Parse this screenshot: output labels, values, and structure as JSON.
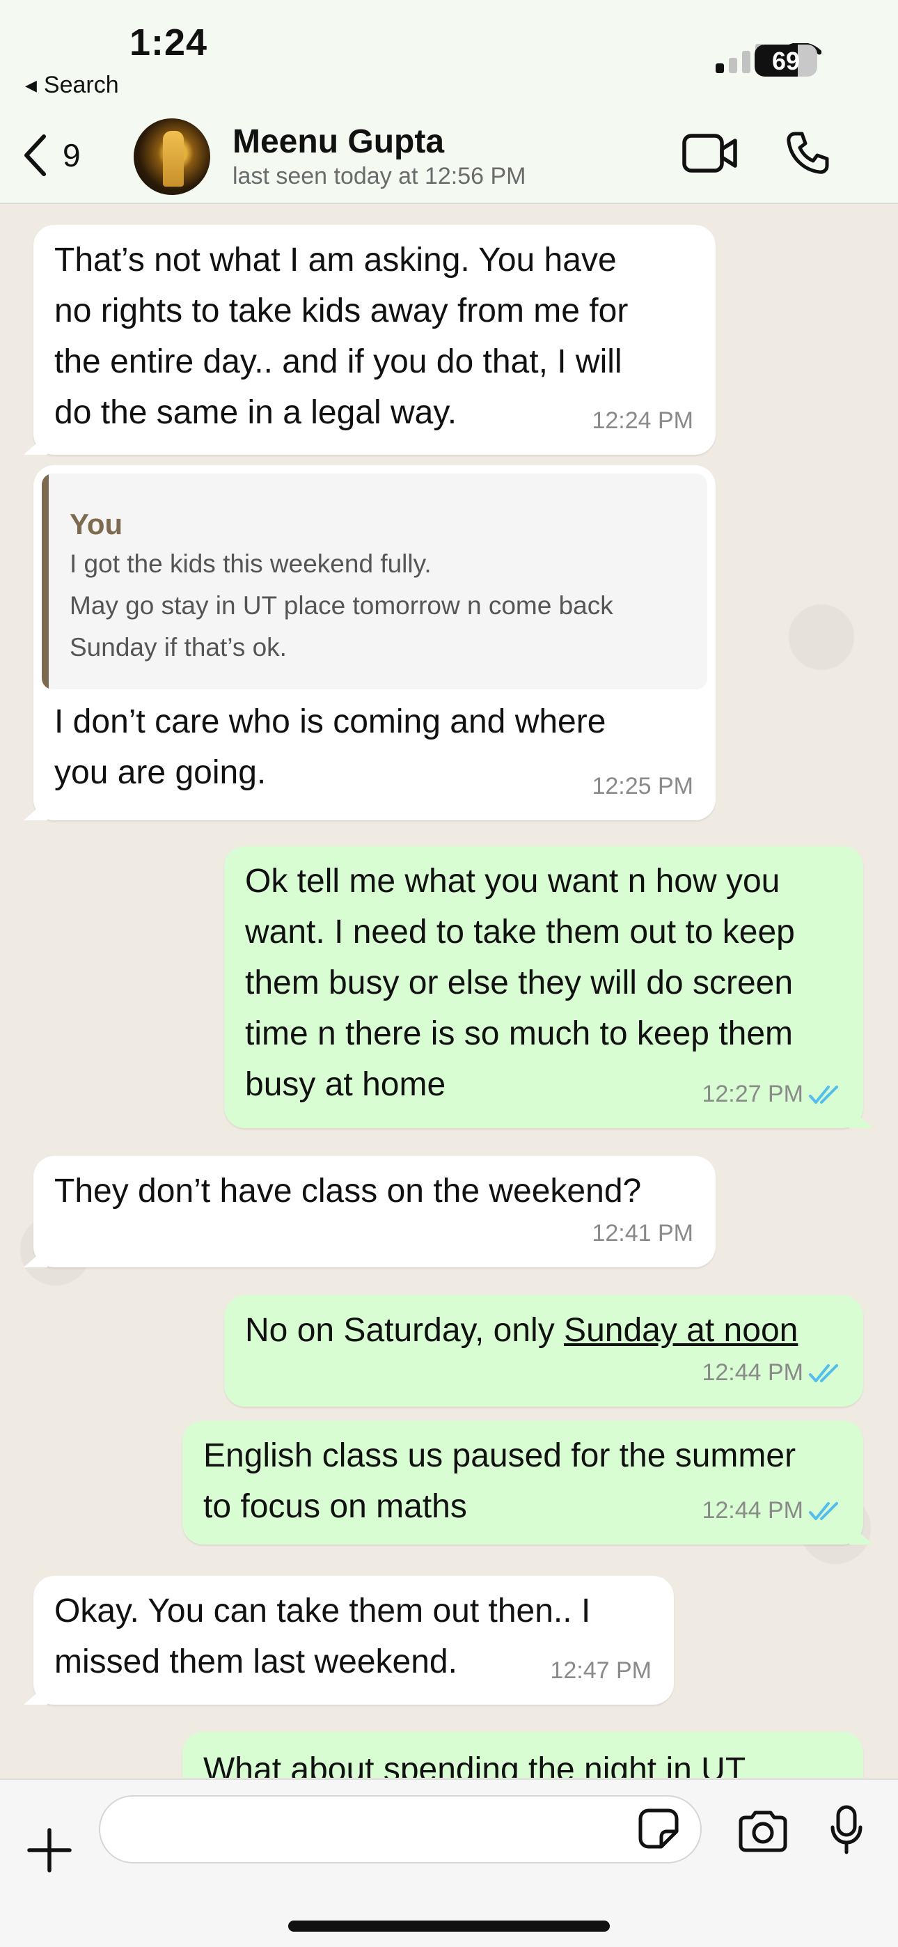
{
  "status_bar": {
    "time": "1:24",
    "back_label": "Search",
    "battery_level": "69",
    "battery_fraction": 0.69
  },
  "header": {
    "back_count": "9",
    "contact_name": "Meenu Gupta",
    "last_seen": "last seen today at 12:56 PM"
  },
  "messages": [
    {
      "direction": "in",
      "text": "That’s not what I am asking. You have\nno rights to take kids away from me for\nthe entire day.. and if you do that, I will\ndo the same in a legal way.",
      "time": "12:24 PM"
    },
    {
      "direction": "in",
      "reply_to": {
        "author": "You",
        "text": "I got the kids this weekend fully.\nMay go stay in UT place tomorrow n come back\nSunday if that’s ok."
      },
      "text": "I don’t care who is coming and where\nyou are going.",
      "time": "12:25 PM"
    },
    {
      "direction": "out",
      "text": "Ok tell me what you want n how you\nwant. I need to take them out to keep\nthem busy or else they will do screen\ntime n there is so much to keep them\nbusy at home",
      "time": "12:27 PM",
      "status": "read"
    },
    {
      "direction": "in",
      "text": "They don’t have class on the weekend?",
      "time": "12:41 PM"
    },
    {
      "direction": "out",
      "text_before": "No on Saturday, only ",
      "link_text": "Sunday at noon",
      "time": "12:44 PM",
      "status": "read"
    },
    {
      "direction": "out",
      "text": "English class us paused for the summer\nto focus on maths",
      "time": "12:44 PM",
      "status": "read"
    },
    {
      "direction": "in",
      "text": "Okay. You can take them out then.. I\nmissed them last weekend.",
      "time": "12:47 PM"
    },
    {
      "direction": "out",
      "text": "What about spending the night in UT",
      "partial": true
    }
  ],
  "composer": {
    "placeholder": ""
  },
  "icons": [
    "chevron-left-icon",
    "video-camera-icon",
    "phone-icon",
    "plus-icon",
    "sticker-icon",
    "camera-icon",
    "microphone-icon",
    "signal-icon",
    "wifi-icon",
    "double-check-icon"
  ],
  "colors": {
    "header_bg": "#f4faf2",
    "chat_bg": "#efeae2",
    "incoming_bubble": "#ffffff",
    "outgoing_bubble": "#d9fdd3",
    "read_ticks": "#53bdeb",
    "quote_accent": "#7d6a4f"
  }
}
